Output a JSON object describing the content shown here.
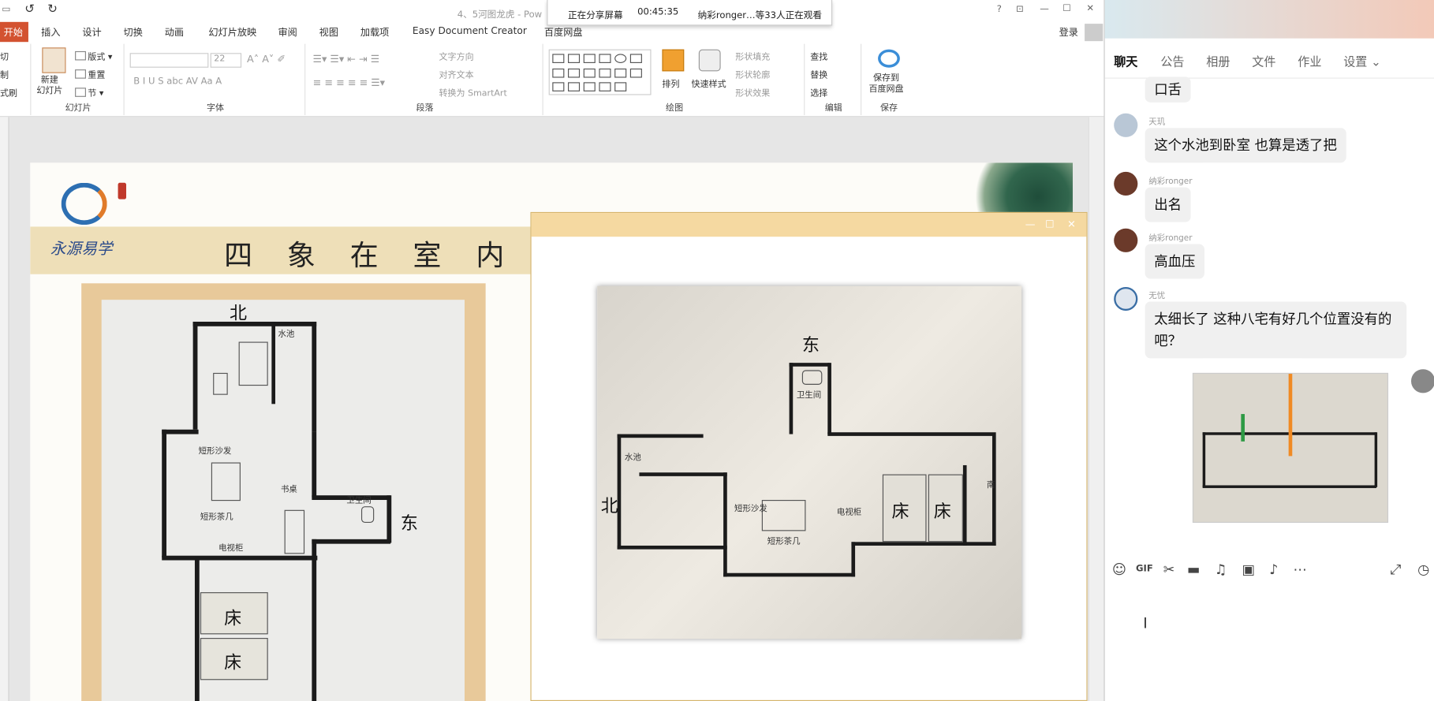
{
  "ppt": {
    "title": "4、5河图龙虎 - Pow",
    "login": "登录",
    "tabs": [
      "开始",
      "插入",
      "设计",
      "切换",
      "动画",
      "幻灯片放映",
      "审阅",
      "视图",
      "加载项",
      "Easy Document Creator",
      "百度网盘"
    ],
    "ribbon": {
      "clip": [
        "切",
        "制",
        "式刷"
      ],
      "new_slide": "新建\n幻灯片",
      "layout": "版式",
      "reset": "重置",
      "section": "节",
      "font_size": "22",
      "text_dir": "文字方向",
      "align_text": "对齐文本",
      "smartart": "转换为 SmartArt",
      "arrange": "排列",
      "quick_style": "快速样式",
      "shape_fill": "形状填充",
      "shape_outline": "形状轮廓",
      "shape_effect": "形状效果",
      "find": "查找",
      "replace": "替换",
      "select": "选择",
      "save_baidu": "保存到\n百度网盘",
      "groups": [
        "幻灯片",
        "字体",
        "段落",
        "绘图",
        "编辑",
        "保存"
      ]
    }
  },
  "slide": {
    "title": "四 象 在 室 内 的 应",
    "brand": "永源易学",
    "plan_left": {
      "north": "北",
      "east": "东",
      "pool": "水池",
      "wc": "卫生间",
      "sofa": "短形沙发",
      "table": "短形茶几",
      "desk": "书桌",
      "bed1": "床",
      "bed2": "床",
      "cabinet": "电视柜"
    }
  },
  "viewer": {
    "plan": {
      "east": "东",
      "north": "北",
      "south": "南",
      "pool": "水池",
      "wc": "卫生间",
      "bed1": "床",
      "bed2": "床",
      "sofa": "短形沙发",
      "table": "短形茶几",
      "cabinet": "电视柜"
    }
  },
  "sharebar": {
    "status": "正在分享屏幕",
    "time": "00:45:35",
    "viewers": "纳彩ronger…等33人正在观看"
  },
  "chat": {
    "tabs": [
      "聊天",
      "公告",
      "相册",
      "文件",
      "作业",
      "设置"
    ],
    "messages": [
      {
        "name": "",
        "text": "口舌"
      },
      {
        "name": "天玑",
        "text": "这个水池到卧室 也算是透了把"
      },
      {
        "name": "纳彩ronger",
        "text": "出名"
      },
      {
        "name": "纳彩ronger",
        "text": "高血压"
      },
      {
        "name": "无忧",
        "text": "太细长了 这种八宅有好几个位置没有的吧？"
      }
    ]
  }
}
